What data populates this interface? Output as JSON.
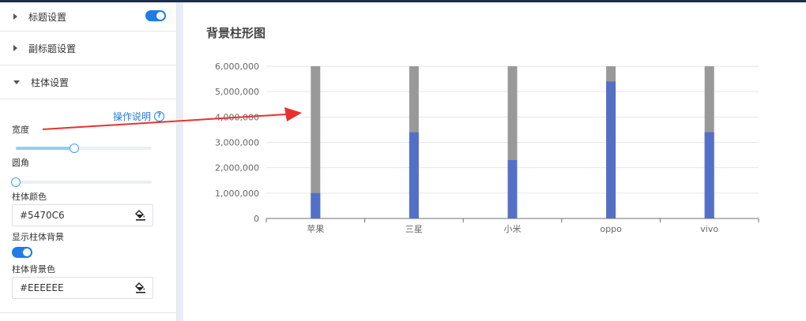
{
  "panel": {
    "sections": [
      {
        "label": "标题设置",
        "expanded": false,
        "toggle_on": true
      },
      {
        "label": "副标题设置",
        "expanded": false
      },
      {
        "label": "柱体设置",
        "expanded": true
      }
    ],
    "help_label": "操作说明",
    "width_label": "宽度",
    "width_slider_value": 0.43,
    "radius_label": "圆角",
    "radius_slider_value": 0,
    "bar_color_label": "柱体颜色",
    "bar_color_value": "#5470C6",
    "show_bg_label": "显示柱体背景",
    "show_bg_on": true,
    "bg_color_label": "柱体背景色",
    "bg_color_value": "#EEEEEE"
  },
  "colors": {
    "accent": "#1e7de6",
    "bar": "#5470c6",
    "bar_background": "#999999",
    "arrow": "#e8312f"
  },
  "chart_data": {
    "type": "bar",
    "title": "背景柱形图",
    "categories": [
      "苹果",
      "三星",
      "小米",
      "oppo",
      "vivo"
    ],
    "values": [
      1000000,
      3400000,
      2300000,
      5400000,
      3400000
    ],
    "ylim": [
      0,
      6000000
    ],
    "yticks": [
      "0",
      "1,000,000",
      "2,000,000",
      "3,000,000",
      "4,000,000",
      "5,000,000",
      "6,000,000"
    ],
    "show_background": true,
    "grid": true
  }
}
